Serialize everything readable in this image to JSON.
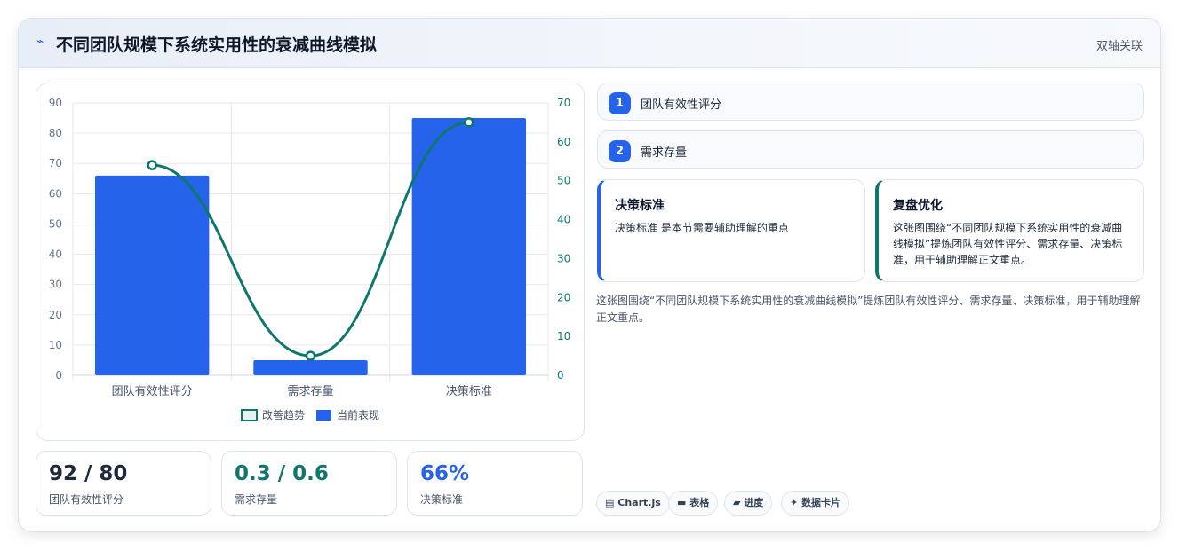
{
  "header": {
    "icon": "bolt-icon",
    "title": "不同团队规模下系统实用性的衰减曲线模拟",
    "tag": "双轴关联"
  },
  "chart_data": {
    "type": "bar",
    "categories": [
      "团队有效性评分",
      "需求存量",
      "决策标准"
    ],
    "series": [
      {
        "name": "当前表现",
        "type": "bar",
        "axis": "left",
        "color": "#2563eb",
        "values": [
          66,
          5,
          85
        ]
      },
      {
        "name": "改善趋势",
        "type": "line",
        "axis": "right",
        "color": "#0f766e",
        "values": [
          54,
          5,
          65
        ]
      }
    ],
    "ylim": [
      0,
      90
    ],
    "y_ticks": [
      0,
      10,
      20,
      30,
      40,
      50,
      60,
      70,
      80,
      90
    ],
    "y2lim": [
      0,
      70
    ],
    "y2_ticks": [
      0,
      10,
      20,
      30,
      40,
      50,
      60,
      70
    ],
    "legend": [
      "改善趋势",
      "当前表现"
    ],
    "legend_position": "bottom",
    "grid": true
  },
  "stats": [
    {
      "value": "92 / 80",
      "label": "团队有效性评分",
      "color": "#1e293b"
    },
    {
      "value": "0.3 / 0.6",
      "label": "需求存量",
      "color": "#0f766e"
    },
    {
      "value": "66%",
      "label": "决策标准",
      "color": "#2563eb"
    }
  ],
  "steps": [
    {
      "num": "1",
      "label": "团队有效性评分"
    },
    {
      "num": "2",
      "label": "需求存量"
    }
  ],
  "notes": [
    {
      "title": "决策标准",
      "body": "决策标准 是本节需要辅助理解的重点",
      "accent": "#2563eb"
    },
    {
      "title": "复盘优化",
      "body": "这张图围绕“不同团队规模下系统实用性的衰减曲线模拟”提炼团队有效性评分、需求存量、决策标准，用于辅助理解正文重点。",
      "accent": "#0f766e"
    }
  ],
  "summary": "这张图围绕“不同团队规模下系统实用性的衰减曲线模拟”提炼团队有效性评分、需求存量、决策标准，用于辅助理解正文重点。",
  "chips": [
    {
      "icon": "chart-icon",
      "glyph": "▤",
      "label": "Chart.js"
    },
    {
      "icon": "table-icon",
      "glyph": "▬",
      "label": "表格"
    },
    {
      "icon": "progress-icon",
      "glyph": "▰",
      "label": "进度"
    },
    {
      "icon": "sparkle-icon",
      "glyph": "✦",
      "label": "数据卡片"
    }
  ]
}
